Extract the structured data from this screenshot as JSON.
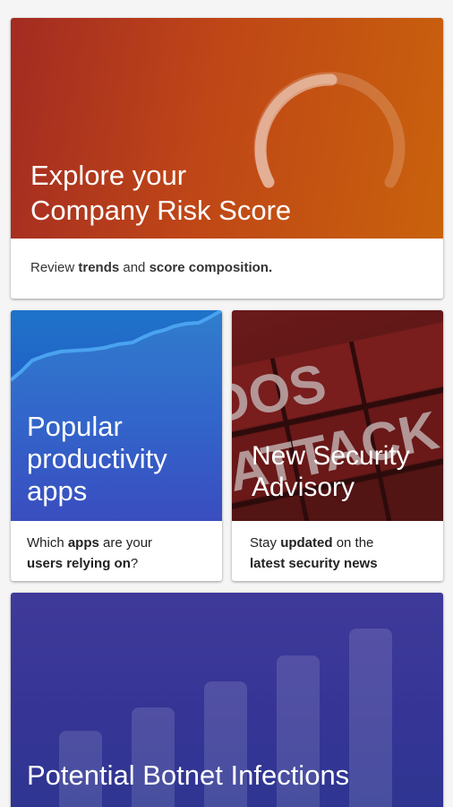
{
  "cards": {
    "risk": {
      "title_line1": "Explore your",
      "title_line2": "Company Risk Score",
      "caption": [
        {
          "text": "Review ",
          "bold": false
        },
        {
          "text": "trends",
          "bold": true
        },
        {
          "text": " and ",
          "bold": false
        },
        {
          "text": "score composition.",
          "bold": true
        }
      ],
      "colors": {
        "from": "#a32b22",
        "to": "#c9620c"
      }
    },
    "apps": {
      "title_line1": "Popular",
      "title_line2": "productivity",
      "title_line3": "apps",
      "caption_line1": [
        {
          "text": "Which ",
          "bold": false
        },
        {
          "text": "apps",
          "bold": true
        },
        {
          "text": " are your",
          "bold": false
        }
      ],
      "caption_line2": [
        {
          "text": "users relying on",
          "bold": true
        },
        {
          "text": "?",
          "bold": false
        }
      ],
      "colors": {
        "from": "#1f73c9",
        "to": "#2a3fba"
      }
    },
    "advisory": {
      "title_line1": "New Security",
      "title_line2": "Advisory",
      "background_text": [
        "DOS",
        "ATTACK"
      ],
      "caption_line1": [
        {
          "text": "Stay ",
          "bold": false
        },
        {
          "text": "updated",
          "bold": true
        },
        {
          "text": " on the",
          "bold": false
        }
      ],
      "caption_line2": [
        {
          "text": "latest security news",
          "bold": true
        }
      ],
      "colors": {
        "from": "#7a1f1f",
        "to": "#3e1414"
      }
    },
    "botnet": {
      "title": "Potential Botnet Infections",
      "bar_levels": [
        0.3,
        0.42,
        0.55,
        0.68,
        0.82
      ],
      "colors": {
        "from": "#3f3a9a",
        "to": "#2d3590"
      }
    }
  }
}
